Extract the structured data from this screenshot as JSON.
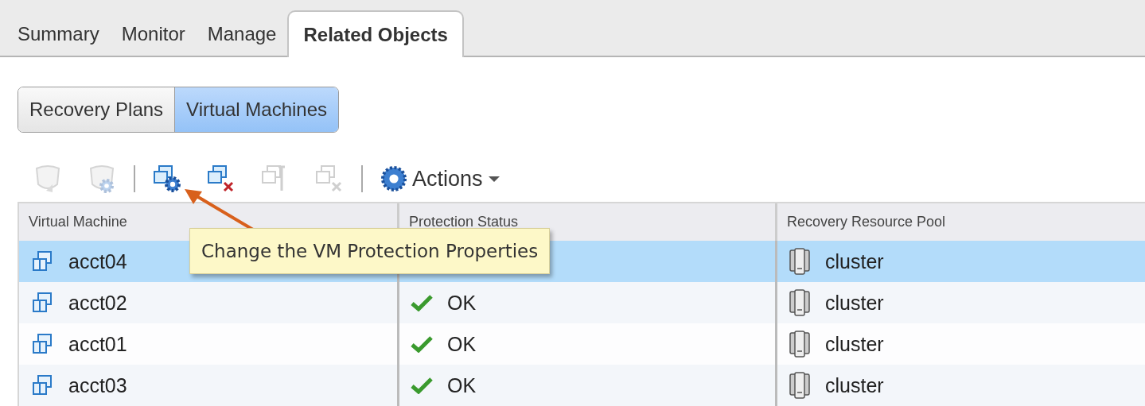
{
  "tabs": [
    {
      "label": "Summary",
      "selected": false
    },
    {
      "label": "Monitor",
      "selected": false
    },
    {
      "label": "Manage",
      "selected": false
    },
    {
      "label": "Related Objects",
      "selected": true
    }
  ],
  "segments": [
    {
      "label": "Recovery Plans",
      "selected": false
    },
    {
      "label": "Virtual Machines",
      "selected": true
    }
  ],
  "toolbar": {
    "items": [
      {
        "kind": "restore",
        "disabled": true
      },
      {
        "kind": "configure",
        "disabled": true
      },
      {
        "kind": "separator"
      },
      {
        "kind": "protect",
        "disabled": false
      },
      {
        "kind": "remove",
        "disabled": false
      },
      {
        "kind": "tools",
        "disabled": true
      },
      {
        "kind": "unprotect",
        "disabled": true
      },
      {
        "kind": "separator"
      }
    ],
    "actions": {
      "label": "Actions"
    }
  },
  "table": {
    "columns": [
      "Virtual Machine",
      "Protection Status",
      "Recovery Resource Pool"
    ],
    "rows": [
      {
        "name": "acct04",
        "selected": true,
        "pool": "cluster"
      },
      {
        "name": "acct02",
        "selected": false,
        "status": "OK",
        "pool": "cluster"
      },
      {
        "name": "acct01",
        "selected": false,
        "status": "OK",
        "pool": "cluster"
      },
      {
        "name": "acct03",
        "selected": false,
        "status": "OK",
        "pool": "cluster"
      }
    ]
  },
  "tooltip": {
    "text": "Change the VM Protection Properties"
  }
}
